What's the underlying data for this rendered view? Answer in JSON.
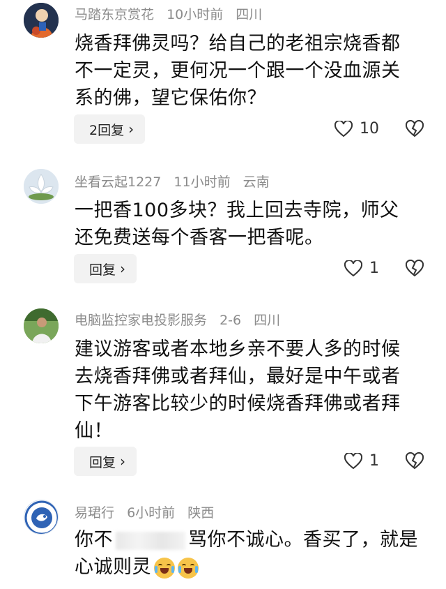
{
  "comments": [
    {
      "username": "马踏东京赏花",
      "time": "10小时前",
      "location": "四川",
      "lines": [
        "烧香拜佛灵吗？给自己的老祖宗烧香都",
        "不一定灵，更何况一个跟一个没血源关",
        "系的佛，望它保佑你？"
      ],
      "reply_label": "2回复",
      "likes": "10"
    },
    {
      "username": "坐看云起1227",
      "time": "11小时前",
      "location": "云南",
      "lines": [
        "一把香100多块？我上回去寺院，师父",
        "还免费送每个香客一把香呢。"
      ],
      "reply_label": "回复",
      "likes": "1"
    },
    {
      "username": "电脑监控家电投影服务",
      "time": "2-6",
      "location": "四川",
      "lines": [
        "建议游客或者本地乡亲不要人多的时候",
        "去烧香拜佛或者拜仙，最好是中午或者",
        "下午游客比较少的时候烧香拜佛或者拜",
        "仙！"
      ],
      "reply_label": "回复",
      "likes": "1"
    },
    {
      "username": "易珺行",
      "time": "6小时前",
      "location": "陕西",
      "line1_start": "你不",
      "line1_end": "骂你不诚心。香买了，就是",
      "line2": "心诚则灵"
    }
  ],
  "reply_chevron": "›",
  "icons": {
    "like": "heart-outline-icon",
    "dislike": "broken-heart-icon"
  },
  "colors": {
    "meta": "#8c8c8c",
    "text": "#111111",
    "reply_bg": "#f2f2f2"
  }
}
